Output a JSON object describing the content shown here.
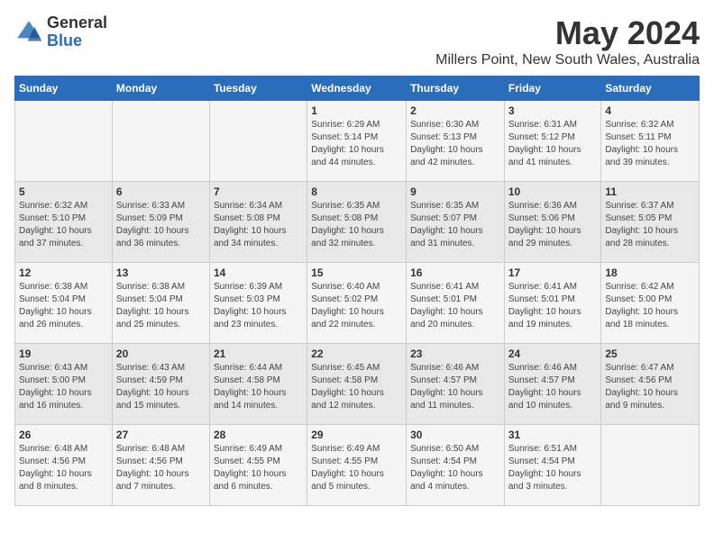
{
  "header": {
    "logo_general": "General",
    "logo_blue": "Blue",
    "title": "May 2024",
    "subtitle": "Millers Point, New South Wales, Australia"
  },
  "days_of_week": [
    "Sunday",
    "Monday",
    "Tuesday",
    "Wednesday",
    "Thursday",
    "Friday",
    "Saturday"
  ],
  "weeks": [
    [
      {
        "day": "",
        "info": ""
      },
      {
        "day": "",
        "info": ""
      },
      {
        "day": "",
        "info": ""
      },
      {
        "day": "1",
        "info": "Sunrise: 6:29 AM\nSunset: 5:14 PM\nDaylight: 10 hours\nand 44 minutes."
      },
      {
        "day": "2",
        "info": "Sunrise: 6:30 AM\nSunset: 5:13 PM\nDaylight: 10 hours\nand 42 minutes."
      },
      {
        "day": "3",
        "info": "Sunrise: 6:31 AM\nSunset: 5:12 PM\nDaylight: 10 hours\nand 41 minutes."
      },
      {
        "day": "4",
        "info": "Sunrise: 6:32 AM\nSunset: 5:11 PM\nDaylight: 10 hours\nand 39 minutes."
      }
    ],
    [
      {
        "day": "5",
        "info": "Sunrise: 6:32 AM\nSunset: 5:10 PM\nDaylight: 10 hours\nand 37 minutes."
      },
      {
        "day": "6",
        "info": "Sunrise: 6:33 AM\nSunset: 5:09 PM\nDaylight: 10 hours\nand 36 minutes."
      },
      {
        "day": "7",
        "info": "Sunrise: 6:34 AM\nSunset: 5:08 PM\nDaylight: 10 hours\nand 34 minutes."
      },
      {
        "day": "8",
        "info": "Sunrise: 6:35 AM\nSunset: 5:08 PM\nDaylight: 10 hours\nand 32 minutes."
      },
      {
        "day": "9",
        "info": "Sunrise: 6:35 AM\nSunset: 5:07 PM\nDaylight: 10 hours\nand 31 minutes."
      },
      {
        "day": "10",
        "info": "Sunrise: 6:36 AM\nSunset: 5:06 PM\nDaylight: 10 hours\nand 29 minutes."
      },
      {
        "day": "11",
        "info": "Sunrise: 6:37 AM\nSunset: 5:05 PM\nDaylight: 10 hours\nand 28 minutes."
      }
    ],
    [
      {
        "day": "12",
        "info": "Sunrise: 6:38 AM\nSunset: 5:04 PM\nDaylight: 10 hours\nand 26 minutes."
      },
      {
        "day": "13",
        "info": "Sunrise: 6:38 AM\nSunset: 5:04 PM\nDaylight: 10 hours\nand 25 minutes."
      },
      {
        "day": "14",
        "info": "Sunrise: 6:39 AM\nSunset: 5:03 PM\nDaylight: 10 hours\nand 23 minutes."
      },
      {
        "day": "15",
        "info": "Sunrise: 6:40 AM\nSunset: 5:02 PM\nDaylight: 10 hours\nand 22 minutes."
      },
      {
        "day": "16",
        "info": "Sunrise: 6:41 AM\nSunset: 5:01 PM\nDaylight: 10 hours\nand 20 minutes."
      },
      {
        "day": "17",
        "info": "Sunrise: 6:41 AM\nSunset: 5:01 PM\nDaylight: 10 hours\nand 19 minutes."
      },
      {
        "day": "18",
        "info": "Sunrise: 6:42 AM\nSunset: 5:00 PM\nDaylight: 10 hours\nand 18 minutes."
      }
    ],
    [
      {
        "day": "19",
        "info": "Sunrise: 6:43 AM\nSunset: 5:00 PM\nDaylight: 10 hours\nand 16 minutes."
      },
      {
        "day": "20",
        "info": "Sunrise: 6:43 AM\nSunset: 4:59 PM\nDaylight: 10 hours\nand 15 minutes."
      },
      {
        "day": "21",
        "info": "Sunrise: 6:44 AM\nSunset: 4:58 PM\nDaylight: 10 hours\nand 14 minutes."
      },
      {
        "day": "22",
        "info": "Sunrise: 6:45 AM\nSunset: 4:58 PM\nDaylight: 10 hours\nand 12 minutes."
      },
      {
        "day": "23",
        "info": "Sunrise: 6:46 AM\nSunset: 4:57 PM\nDaylight: 10 hours\nand 11 minutes."
      },
      {
        "day": "24",
        "info": "Sunrise: 6:46 AM\nSunset: 4:57 PM\nDaylight: 10 hours\nand 10 minutes."
      },
      {
        "day": "25",
        "info": "Sunrise: 6:47 AM\nSunset: 4:56 PM\nDaylight: 10 hours\nand 9 minutes."
      }
    ],
    [
      {
        "day": "26",
        "info": "Sunrise: 6:48 AM\nSunset: 4:56 PM\nDaylight: 10 hours\nand 8 minutes."
      },
      {
        "day": "27",
        "info": "Sunrise: 6:48 AM\nSunset: 4:56 PM\nDaylight: 10 hours\nand 7 minutes."
      },
      {
        "day": "28",
        "info": "Sunrise: 6:49 AM\nSunset: 4:55 PM\nDaylight: 10 hours\nand 6 minutes."
      },
      {
        "day": "29",
        "info": "Sunrise: 6:49 AM\nSunset: 4:55 PM\nDaylight: 10 hours\nand 5 minutes."
      },
      {
        "day": "30",
        "info": "Sunrise: 6:50 AM\nSunset: 4:54 PM\nDaylight: 10 hours\nand 4 minutes."
      },
      {
        "day": "31",
        "info": "Sunrise: 6:51 AM\nSunset: 4:54 PM\nDaylight: 10 hours\nand 3 minutes."
      },
      {
        "day": "",
        "info": ""
      }
    ]
  ]
}
